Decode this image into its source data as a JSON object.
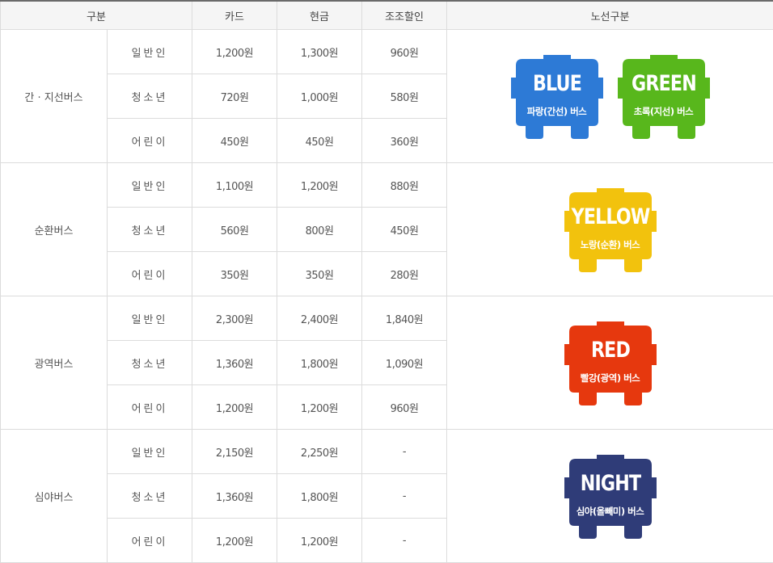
{
  "header": {
    "category": "구분",
    "card": "카드",
    "cash": "현금",
    "youth_discount": "조조할인",
    "route_type": "노선구분"
  },
  "groups": [
    {
      "name": "간 · 지선버스",
      "rows": [
        {
          "rider": "일반인",
          "card": "1,200원",
          "cash": "1,300원",
          "early": "960원"
        },
        {
          "rider": "청소년",
          "card": "720원",
          "cash": "1,000원",
          "early": "580원"
        },
        {
          "rider": "어린이",
          "card": "450원",
          "cash": "450원",
          "early": "360원"
        }
      ],
      "badges": [
        {
          "name": "BLUE",
          "desc": "파랑(간선) 버스",
          "color": "#2d7ad6"
        },
        {
          "name": "GREEN",
          "desc": "초록(지선) 버스",
          "color": "#58b71c"
        }
      ]
    },
    {
      "name": "순환버스",
      "rows": [
        {
          "rider": "일반인",
          "card": "1,100원",
          "cash": "1,200원",
          "early": "880원"
        },
        {
          "rider": "청소년",
          "card": "560원",
          "cash": "800원",
          "early": "450원"
        },
        {
          "rider": "어린이",
          "card": "350원",
          "cash": "350원",
          "early": "280원"
        }
      ],
      "badges": [
        {
          "name": "YELLOW",
          "desc": "노랑(순환) 버스",
          "color": "#f2c20d"
        }
      ]
    },
    {
      "name": "광역버스",
      "rows": [
        {
          "rider": "일반인",
          "card": "2,300원",
          "cash": "2,400원",
          "early": "1,840원"
        },
        {
          "rider": "청소년",
          "card": "1,360원",
          "cash": "1,800원",
          "early": "1,090원"
        },
        {
          "rider": "어린이",
          "card": "1,200원",
          "cash": "1,200원",
          "early": "960원"
        }
      ],
      "badges": [
        {
          "name": "RED",
          "desc": "빨강(광역) 버스",
          "color": "#e6380e"
        }
      ]
    },
    {
      "name": "심야버스",
      "rows": [
        {
          "rider": "일반인",
          "card": "2,150원",
          "cash": "2,250원",
          "early": "-"
        },
        {
          "rider": "청소년",
          "card": "1,360원",
          "cash": "1,800원",
          "early": "-"
        },
        {
          "rider": "어린이",
          "card": "1,200원",
          "cash": "1,200원",
          "early": "-"
        }
      ],
      "badges": [
        {
          "name": "NIGHT",
          "desc": "심야(올빼미) 버스",
          "color": "#2f3c78"
        }
      ]
    }
  ]
}
